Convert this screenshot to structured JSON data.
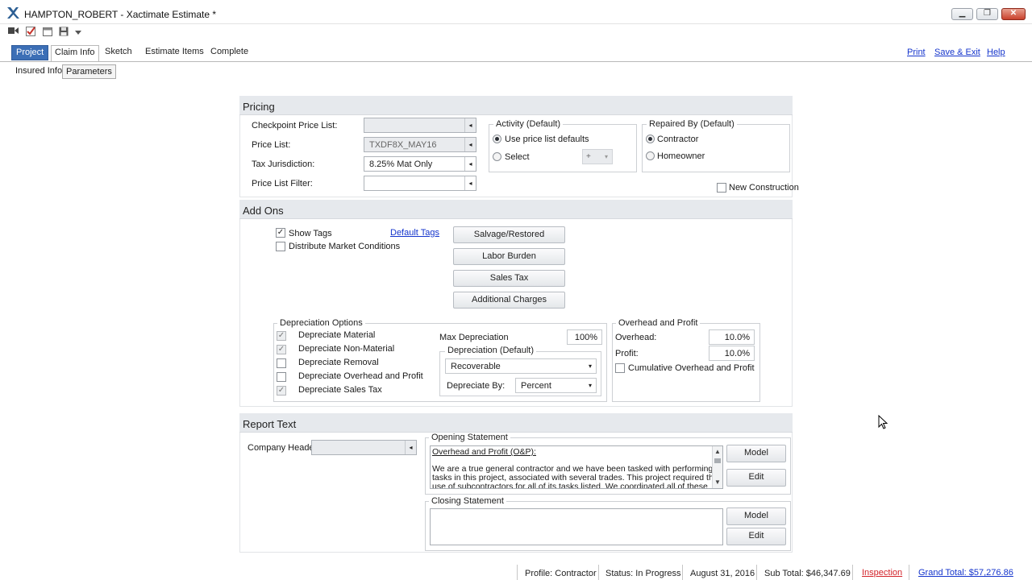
{
  "window": {
    "title": "HAMPTON_ROBERT - Xactimate Estimate *",
    "min_glyph": "▁",
    "max_glyph": "❐",
    "close_glyph": "✕"
  },
  "quick_access": [
    "video-icon",
    "check-icon",
    "calendar-icon",
    "save-icon",
    "dropdown-icon"
  ],
  "tabs": {
    "project": "Project",
    "claim_info": "Claim Info",
    "sketch": "Sketch",
    "estimate_items": "Estimate Items",
    "complete": "Complete"
  },
  "top_links": {
    "print": "Print",
    "save_exit": "Save & Exit",
    "help": "Help"
  },
  "subtabs": {
    "insured_info": "Insured Info",
    "parameters": "Parameters"
  },
  "pricing": {
    "title": "Pricing",
    "checkpoint_label": "Checkpoint Price List:",
    "checkpoint_value": "",
    "price_list_label": "Price List:",
    "price_list_value": "TXDF8X_MAY16",
    "tax_label": "Tax Jurisdiction:",
    "tax_value": "8.25% Mat Only",
    "filter_label": "Price List Filter:",
    "filter_value": "",
    "activity": {
      "title": "Activity (Default)",
      "use_defaults": "Use price list defaults",
      "select": "Select",
      "select_value": "+"
    },
    "repaired_by": {
      "title": "Repaired By (Default)",
      "contractor": "Contractor",
      "homeowner": "Homeowner"
    },
    "new_construction": "New Construction"
  },
  "addons": {
    "title": "Add Ons",
    "show_tags": "Show Tags",
    "default_tags": "Default Tags",
    "distribute_market": "Distribute Market Conditions",
    "buttons": {
      "salvage": "Salvage/Restored",
      "labor": "Labor Burden",
      "sales_tax": "Sales Tax",
      "additional": "Additional Charges"
    },
    "depreciation": {
      "title": "Depreciation Options",
      "material": "Depreciate Material",
      "non_material": "Depreciate Non-Material",
      "removal": "Depreciate Removal",
      "overhead": "Depreciate Overhead and Profit",
      "sales_tax": "Depreciate Sales Tax",
      "max_label": "Max Depreciation",
      "max_value": "100%",
      "default_title": "Depreciation (Default)",
      "default_value": "Recoverable",
      "by_label": "Depreciate By:",
      "by_value": "Percent"
    },
    "overhead_profit": {
      "title": "Overhead and Profit",
      "overhead_label": "Overhead:",
      "overhead_value": "10.0%",
      "profit_label": "Profit:",
      "profit_value": "10.0%",
      "cumulative": "Cumulative Overhead and Profit"
    }
  },
  "report": {
    "title": "Report Text",
    "company_header_label": "Company Header:",
    "opening": {
      "title": "Opening Statement",
      "heading": "Overhead and Profit (O&P):",
      "line1": "We are a true general contractor and we have been tasked with performing all",
      "line2": "tasks in this project, associated with several trades. This project required the",
      "line3": "use of subcontractors for all of its tasks listed. We coordinated all of these"
    },
    "closing": {
      "title": "Closing Statement"
    },
    "model": "Model",
    "edit": "Edit"
  },
  "status": {
    "profile": "Profile:  Contractor",
    "state": "Status:  In Progress",
    "date": "August 31, 2016",
    "subtotal": "Sub Total: $46,347.69",
    "inspection": "Inspection",
    "grand_total": "Grand Total: $57,276.86"
  },
  "colors": {
    "accent": "#3c6fb6",
    "link": "#1434cc",
    "inspection": "#d3232a",
    "section_header": "#e6e9ed"
  }
}
